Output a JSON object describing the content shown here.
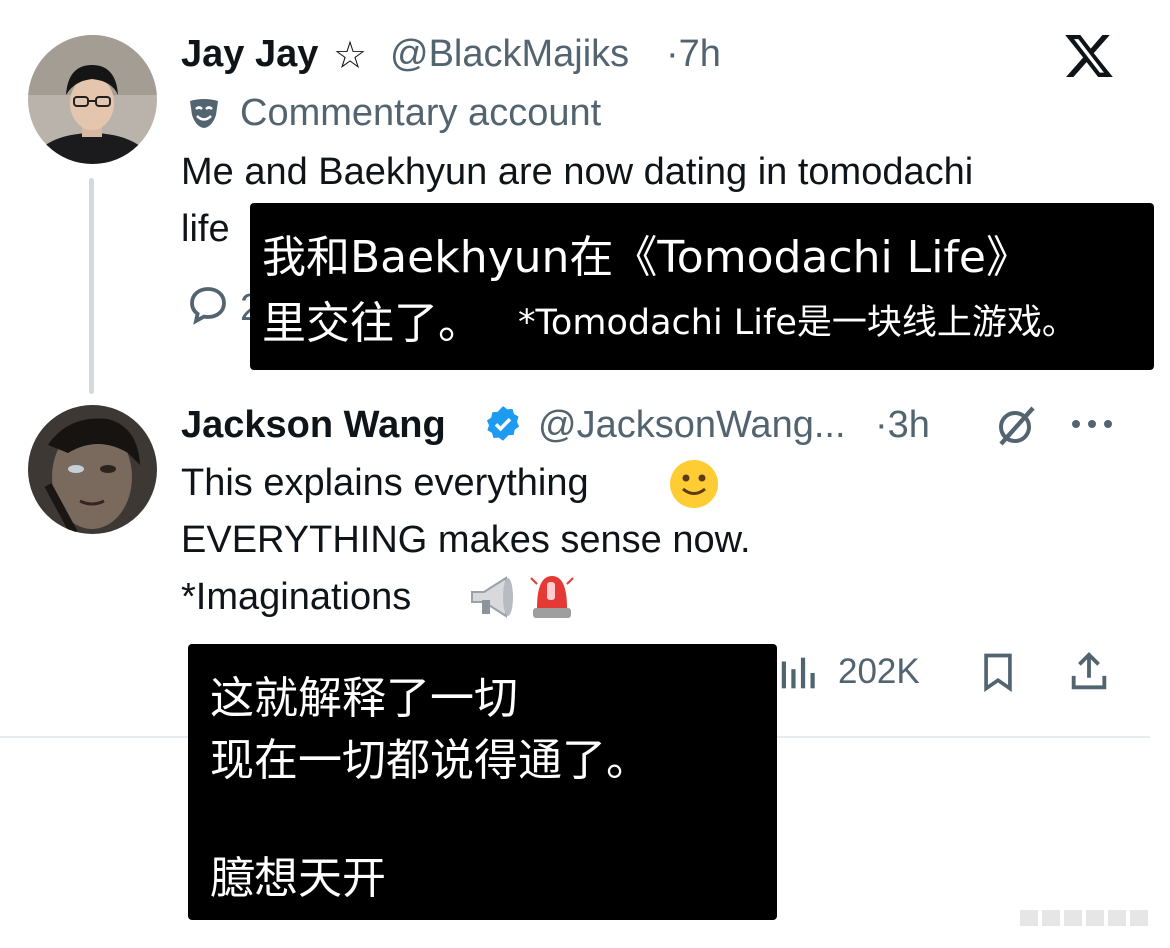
{
  "tweet1": {
    "display_name": "Jay Jay",
    "star_glyph": "☆",
    "handle": "@BlackMajiks",
    "time": "·7h",
    "label_icon": "theater-mask-icon",
    "label_text": "Commentary account",
    "text_line1": "Me and Baekhyun are now dating in tomodachi",
    "text_line2": "life",
    "reply_count_partial": "2"
  },
  "caption1": {
    "line1": "我和Baekhyun在《Tomodachi Life》",
    "line2_main": "里交往了。",
    "line2_note": "*Tomodachi Life是一块线上游戏。"
  },
  "tweet2": {
    "display_name": "Jackson Wang",
    "verified_icon": "verified-badge-icon",
    "handle": "@JacksonWang...",
    "time": "·3h",
    "line1": "This explains everything",
    "line1_emoji": "slightly-smiling-face-emoji",
    "line2": "EVERYTHING makes sense now.",
    "line3": "*Imaginations",
    "line3_emojis": [
      "loudspeaker-emoji",
      "police-light-emoji"
    ],
    "views": "202K"
  },
  "caption2": {
    "line1": "这就解释了一切",
    "line2": "现在一切都说得通了。",
    "line3": "臆想天开"
  },
  "colors": {
    "text_primary": "#0f1419",
    "text_muted": "#536471",
    "verified_blue": "#1d9bf0",
    "caption_bg": "#000000",
    "thread_line": "#cfd9de"
  }
}
